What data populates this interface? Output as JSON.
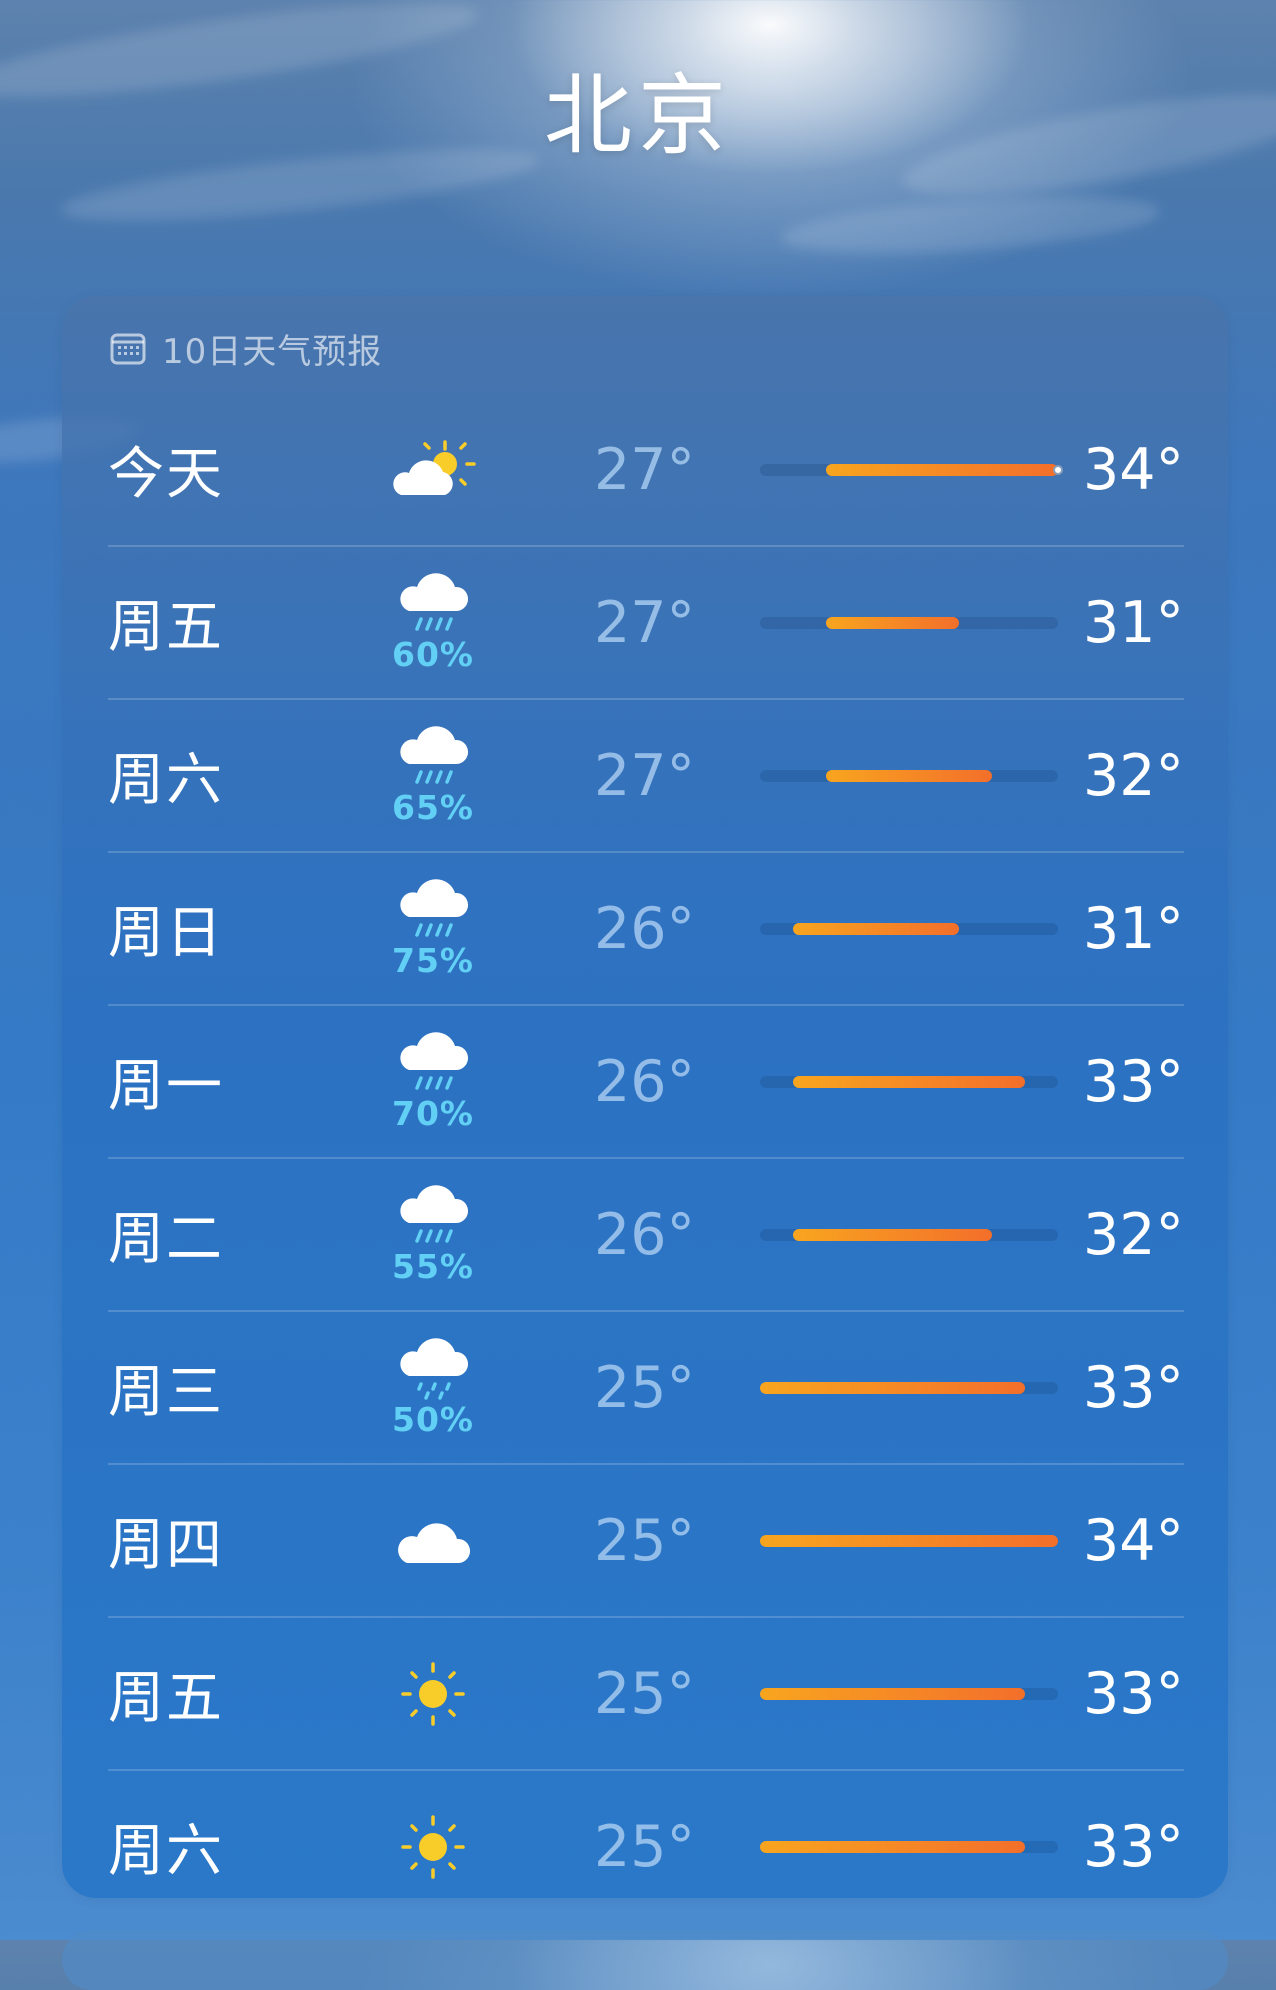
{
  "city": "北京",
  "forecast": {
    "header": "10日天气预报",
    "header_icon": "calendar-icon",
    "colors": {
      "precip": "#62d0f5",
      "bar_start": "#f8a51f",
      "bar_end": "#f36f2b",
      "low_temp": "#aacdf0"
    },
    "range_min": 25,
    "range_max": 34,
    "days": [
      {
        "day": "今天",
        "icon": "partly-sunny",
        "precip": "",
        "low": "27°",
        "high": "34°",
        "lo": 27,
        "hi": 34,
        "current": 34
      },
      {
        "day": "周五",
        "icon": "rain",
        "precip": "60%",
        "low": "27°",
        "high": "31°",
        "lo": 27,
        "hi": 31
      },
      {
        "day": "周六",
        "icon": "rain",
        "precip": "65%",
        "low": "27°",
        "high": "32°",
        "lo": 27,
        "hi": 32
      },
      {
        "day": "周日",
        "icon": "rain",
        "precip": "75%",
        "low": "26°",
        "high": "31°",
        "lo": 26,
        "hi": 31
      },
      {
        "day": "周一",
        "icon": "rain",
        "precip": "70%",
        "low": "26°",
        "high": "33°",
        "lo": 26,
        "hi": 33
      },
      {
        "day": "周二",
        "icon": "rain",
        "precip": "55%",
        "low": "26°",
        "high": "32°",
        "lo": 26,
        "hi": 32
      },
      {
        "day": "周三",
        "icon": "drizzle",
        "precip": "50%",
        "low": "25°",
        "high": "33°",
        "lo": 25,
        "hi": 33
      },
      {
        "day": "周四",
        "icon": "cloud",
        "precip": "",
        "low": "25°",
        "high": "34°",
        "lo": 25,
        "hi": 34
      },
      {
        "day": "周五",
        "icon": "sun",
        "precip": "",
        "low": "25°",
        "high": "33°",
        "lo": 25,
        "hi": 33
      },
      {
        "day": "周六",
        "icon": "sun",
        "precip": "",
        "low": "25°",
        "high": "33°",
        "lo": 25,
        "hi": 33
      }
    ]
  }
}
